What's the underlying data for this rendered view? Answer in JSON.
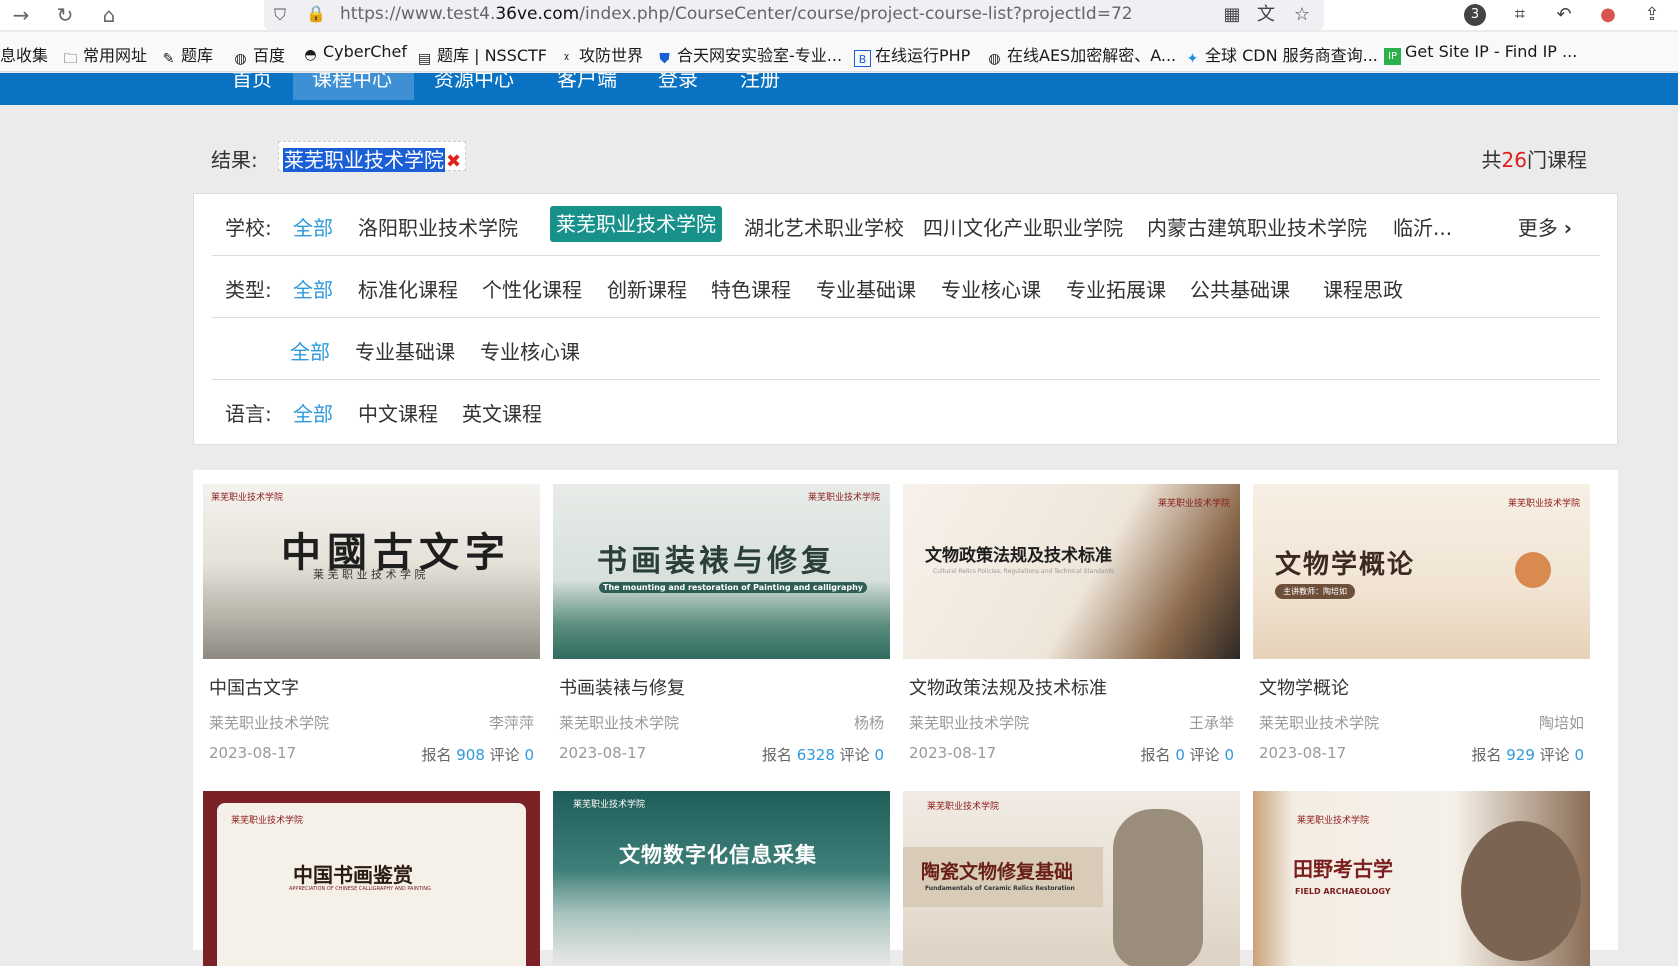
{
  "browser": {
    "url_prefix": "https://www.test4.",
    "url_host": "36ve.com",
    "url_path": "/index.php/CourseCenter/course/project-course-list?projectId=72",
    "extensions_badge": "3"
  },
  "bookmarks": [
    {
      "label": "息收集",
      "icon": "folder-icon"
    },
    {
      "label": "常用网址",
      "icon": "folder-icon"
    },
    {
      "label": "题库",
      "icon": "site-icon"
    },
    {
      "label": "百度",
      "icon": "globe-icon"
    },
    {
      "label": "CyberChef",
      "icon": "chef-icon"
    },
    {
      "label": "题库 | NSSCTF",
      "icon": "site-icon"
    },
    {
      "label": "攻防世界",
      "icon": "site-icon"
    },
    {
      "label": "合天网安实验室-专业...",
      "icon": "shield-icon"
    },
    {
      "label": "在线运行PHP",
      "icon": "b-icon"
    },
    {
      "label": "在线AES加密解密、A...",
      "icon": "globe-icon"
    },
    {
      "label": "全球 CDN 服务商查询...",
      "icon": "cdn-icon"
    },
    {
      "label": "Get Site IP - Find IP ...",
      "icon": "ip-icon"
    }
  ],
  "sitenav": {
    "items": [
      "首页",
      "课程中心",
      "资源中心",
      "客户端",
      "登录",
      "注册"
    ],
    "active": "课程中心"
  },
  "result": {
    "label": "结果:",
    "tag": "莱芜职业技术学院",
    "count_prefix": "共",
    "count": "26",
    "count_suffix": "门课程"
  },
  "filters": {
    "school": {
      "label": "学校:",
      "options": [
        "全部",
        "洛阳职业技术学院",
        "莱芜职业技术学院",
        "湖北艺术职业学校",
        "四川文化产业职业学院",
        "内蒙古建筑职业技术学院",
        "临沂..."
      ],
      "selected": "莱芜职业技术学院",
      "more": "更多"
    },
    "type": {
      "label": "类型:",
      "options": [
        "全部",
        "标准化课程",
        "个性化课程",
        "创新课程",
        "特色课程",
        "专业基础课",
        "专业核心课",
        "专业拓展课",
        "公共基础课",
        "课程思政"
      ]
    },
    "sub": {
      "label": "",
      "options": [
        "全部",
        "专业基础课",
        "专业核心课"
      ]
    },
    "language": {
      "label": "语言:",
      "options": [
        "全部",
        "中文课程",
        "英文课程"
      ]
    }
  },
  "courses": [
    {
      "title": "中国古文字",
      "thumb_title": "中國古文字",
      "thumb_sub": "莱 芜 职 业 技 术 学 院",
      "school": "莱芜职业技术学院",
      "teacher": "李萍萍",
      "date": "2023-08-17",
      "enroll_label": "报名",
      "enroll": "908",
      "comment_label": "评论",
      "comments": "0"
    },
    {
      "title": "书画装裱与修复",
      "thumb_title": "书画装裱与修复",
      "thumb_sub": "The mounting and restoration of Painting and calligraphy",
      "school": "莱芜职业技术学院",
      "teacher": "杨杨",
      "date": "2023-08-17",
      "enroll_label": "报名",
      "enroll": "6328",
      "comment_label": "评论",
      "comments": "0"
    },
    {
      "title": "文物政策法规及技术标准",
      "thumb_title": "文物政策法规及技术标准",
      "thumb_sub": "Cultural Relics Policies, Regulations and Technical Standards",
      "school": "莱芜职业技术学院",
      "teacher": "王承举",
      "date": "2023-08-17",
      "enroll_label": "报名",
      "enroll": "0",
      "comment_label": "评论",
      "comments": "0"
    },
    {
      "title": "文物学概论",
      "thumb_title": "文物学概论",
      "thumb_sub": "主讲教师：陶培如",
      "school": "莱芜职业技术学院",
      "teacher": "陶培如",
      "date": "2023-08-17",
      "enroll_label": "报名",
      "enroll": "929",
      "comment_label": "评论",
      "comments": "0"
    },
    {
      "thumb_title": "中国书画鉴赏",
      "thumb_sub": "APPRECIATION OF CHINESE CALLIGRAPHY AND PAINTING"
    },
    {
      "thumb_title": "文物数字化信息采集"
    },
    {
      "thumb_title": "陶瓷文物修复基础",
      "thumb_sub": "Fundamentals of Ceramic Relics Restoration"
    },
    {
      "thumb_title": "田野考古学",
      "thumb_sub": "FIELD ARCHAEOLOGY"
    }
  ],
  "thumb_logo": "莱芜职业技术学院",
  "colors": {
    "nav": "#0a72c2",
    "accent": "#2f9adb",
    "pill": "#18918b",
    "count": "#e21b1b"
  }
}
